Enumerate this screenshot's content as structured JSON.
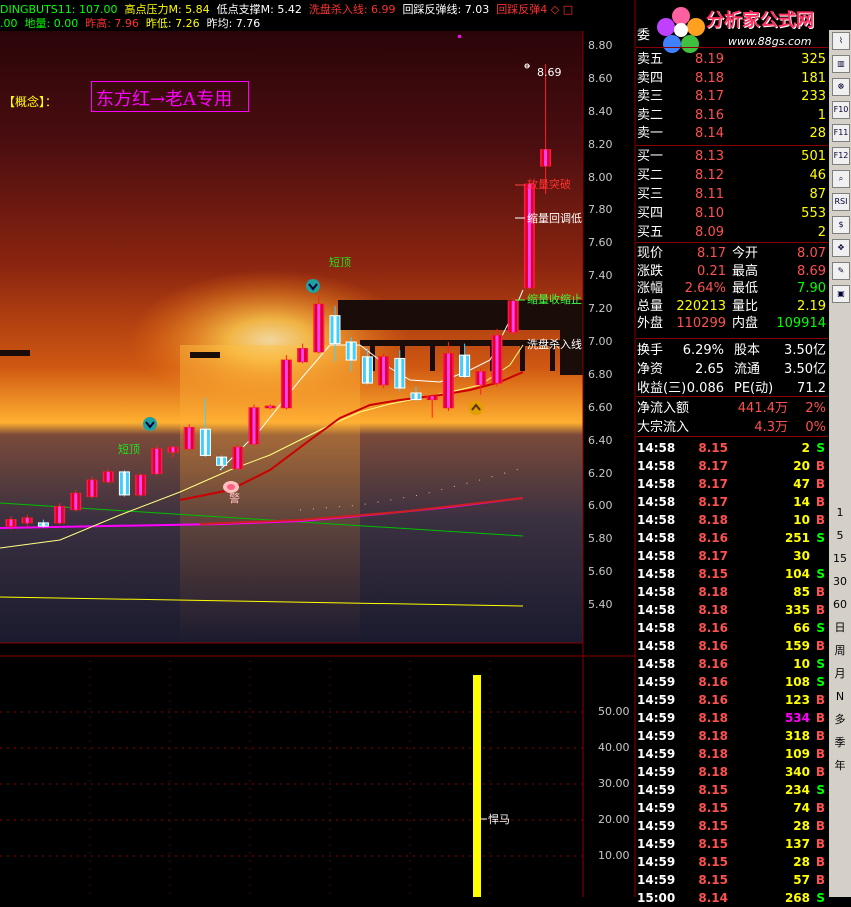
{
  "indicator_line1": [
    {
      "text": "DINGBUTS11: 107.00",
      "color": "#00ff00"
    },
    {
      "text": "高点压力M: 5.84",
      "color": "#ffff00"
    },
    {
      "text": "低点支撑M: 5.42",
      "color": "#ffffff"
    },
    {
      "text": "洗盘杀入线: 6.99",
      "color": "#ff3030"
    },
    {
      "text": "回踩反弹线: 7.03",
      "color": "#ffffff"
    },
    {
      "text": "回踩反弹4 ◇ □",
      "color": "#ff3030"
    }
  ],
  "indicator_line2": [
    {
      "text": ".00",
      "color": "#00ff00"
    },
    {
      "text": "地量: 0.00",
      "color": "#00ff00"
    },
    {
      "text": "昨高: 7.96",
      "color": "#ff3030"
    },
    {
      "text": "昨低: 7.26",
      "color": "#ffff00"
    },
    {
      "text": "昨均: 7.76",
      "color": "#ffffff"
    }
  ],
  "concept_label": "【概念】：",
  "banner": "东方红→老A专用",
  "chart_labels": {
    "peak_value": "8.69",
    "volume_breakout": "放量突破",
    "shrink_pullback": "缩量回调低",
    "shrink_consolidation": "缩量收缩止",
    "washout_entry": "洗盘杀入线",
    "short_top_1": "短顶",
    "short_top_2": "短顶",
    "warning": "警",
    "lower_marker": "悍马"
  },
  "chart_data": {
    "type": "candlestick",
    "y_axis_ticks": [
      "8.80",
      "8.60",
      "8.40",
      "8.20",
      "8.00",
      "7.80",
      "7.60",
      "7.40",
      "7.20",
      "7.00",
      "6.80",
      "6.60",
      "6.40",
      "6.20",
      "6.00",
      "5.80",
      "5.60",
      "5.40"
    ],
    "candles": [
      {
        "o": 5.88,
        "c": 5.92,
        "h": 5.94,
        "l": 5.86
      },
      {
        "o": 5.9,
        "c": 5.93,
        "h": 5.95,
        "l": 5.88
      },
      {
        "o": 5.9,
        "c": 5.88,
        "h": 5.92,
        "l": 5.87
      },
      {
        "o": 5.9,
        "c": 6.0,
        "h": 6.02,
        "l": 5.89
      },
      {
        "o": 5.98,
        "c": 6.08,
        "h": 6.1,
        "l": 5.97
      },
      {
        "o": 6.06,
        "c": 6.16,
        "h": 6.18,
        "l": 6.05
      },
      {
        "o": 6.15,
        "c": 6.21,
        "h": 6.23,
        "l": 6.14
      },
      {
        "o": 6.21,
        "c": 6.07,
        "h": 6.22,
        "l": 6.06
      },
      {
        "o": 6.07,
        "c": 6.19,
        "h": 6.2,
        "l": 6.06
      },
      {
        "o": 6.2,
        "c": 6.35,
        "h": 6.37,
        "l": 6.19
      },
      {
        "o": 6.33,
        "c": 6.36,
        "h": 6.37,
        "l": 6.3
      },
      {
        "o": 6.35,
        "c": 6.48,
        "h": 6.5,
        "l": 6.34
      },
      {
        "o": 6.47,
        "c": 6.31,
        "h": 6.66,
        "l": 6.3
      },
      {
        "o": 6.3,
        "c": 6.25,
        "h": 6.31,
        "l": 6.22
      },
      {
        "o": 6.23,
        "c": 6.36,
        "h": 6.38,
        "l": 6.22
      },
      {
        "o": 6.38,
        "c": 6.6,
        "h": 6.62,
        "l": 6.37
      },
      {
        "o": 6.6,
        "c": 6.61,
        "h": 6.62,
        "l": 6.59
      },
      {
        "o": 6.6,
        "c": 6.89,
        "h": 6.92,
        "l": 6.59
      },
      {
        "o": 6.88,
        "c": 6.96,
        "h": 6.99,
        "l": 6.87
      },
      {
        "o": 6.94,
        "c": 7.23,
        "h": 7.28,
        "l": 6.93
      },
      {
        "o": 7.16,
        "c": 6.99,
        "h": 7.22,
        "l": 6.88
      },
      {
        "o": 7.0,
        "c": 6.89,
        "h": 7.03,
        "l": 6.82
      },
      {
        "o": 6.91,
        "c": 6.75,
        "h": 6.96,
        "l": 6.74
      },
      {
        "o": 6.74,
        "c": 6.91,
        "h": 6.93,
        "l": 6.72
      },
      {
        "o": 6.9,
        "c": 6.72,
        "h": 6.95,
        "l": 6.7
      },
      {
        "o": 6.69,
        "c": 6.65,
        "h": 6.73,
        "l": 6.64
      },
      {
        "o": 6.65,
        "c": 6.67,
        "h": 6.68,
        "l": 6.54
      },
      {
        "o": 6.6,
        "c": 6.93,
        "h": 7.0,
        "l": 6.58
      },
      {
        "o": 6.92,
        "c": 6.79,
        "h": 6.99,
        "l": 6.78
      },
      {
        "o": 6.74,
        "c": 6.82,
        "h": 6.84,
        "l": 6.68
      },
      {
        "o": 6.75,
        "c": 7.04,
        "h": 7.08,
        "l": 6.73
      },
      {
        "o": 7.06,
        "c": 7.25,
        "h": 7.27,
        "l": 7.04
      },
      {
        "o": 7.33,
        "c": 7.96,
        "h": 7.98,
        "l": 7.32
      },
      {
        "o": 8.07,
        "c": 8.17,
        "h": 8.69,
        "l": 7.9
      }
    ]
  },
  "volume_axis_ticks": [
    "50.00",
    "40.00",
    "30.00",
    "20.00",
    "10.00"
  ],
  "quote_title": "委",
  "sell_orders": [
    {
      "label": "卖五",
      "price": "8.19",
      "vol": "325"
    },
    {
      "label": "卖四",
      "price": "8.18",
      "vol": "181"
    },
    {
      "label": "卖三",
      "price": "8.17",
      "vol": "233"
    },
    {
      "label": "卖二",
      "price": "8.16",
      "vol": "1"
    },
    {
      "label": "卖一",
      "price": "8.14",
      "vol": "28"
    }
  ],
  "buy_orders": [
    {
      "label": "买一",
      "price": "8.13",
      "vol": "501"
    },
    {
      "label": "买二",
      "price": "8.12",
      "vol": "46"
    },
    {
      "label": "买三",
      "price": "8.11",
      "vol": "87"
    },
    {
      "label": "买四",
      "price": "8.10",
      "vol": "553"
    },
    {
      "label": "买五",
      "price": "8.09",
      "vol": "2"
    }
  ],
  "stats": [
    {
      "k1": "现价",
      "v1": "8.17",
      "k2": "今开",
      "v2": "8.07",
      "c1": "#ff5050",
      "c2": "#ff5050"
    },
    {
      "k1": "涨跌",
      "v1": "0.21",
      "k2": "最高",
      "v2": "8.69",
      "c1": "#ff5050",
      "c2": "#ff5050"
    },
    {
      "k1": "涨幅",
      "v1": "2.64%",
      "k2": "最低",
      "v2": "7.90",
      "c1": "#ff5050",
      "c2": "#00ff00"
    },
    {
      "k1": "总量",
      "v1": "220213",
      "k2": "量比",
      "v2": "2.19",
      "c1": "#ffff00",
      "c2": "#ffff00"
    },
    {
      "k1": "外盘",
      "v1": "110299",
      "k2": "内盘",
      "v2": "109914",
      "c1": "#ff5050",
      "c2": "#00ff00"
    }
  ],
  "finance": [
    {
      "k1": "换手",
      "v1": "6.29%",
      "k2": "股本",
      "v2": "3.50亿"
    },
    {
      "k1": "净资",
      "v1": "2.65",
      "k2": "流通",
      "v2": "3.50亿"
    },
    {
      "k1": "收益(三)",
      "v1": "0.086",
      "k2": "PE(动)",
      "v2": "71.2"
    }
  ],
  "flows": [
    {
      "k": "净流入额",
      "v": "441.4万",
      "p": "2%"
    },
    {
      "k": "大宗流入",
      "v": "4.3万",
      "p": "0%"
    }
  ],
  "ticks": [
    {
      "t": "14:58",
      "p": "8.15",
      "v": "2",
      "s": "S"
    },
    {
      "t": "14:58",
      "p": "8.17",
      "v": "20",
      "s": "B"
    },
    {
      "t": "14:58",
      "p": "8.17",
      "v": "47",
      "s": "B"
    },
    {
      "t": "14:58",
      "p": "8.17",
      "v": "14",
      "s": "B"
    },
    {
      "t": "14:58",
      "p": "8.18",
      "v": "10",
      "s": "B"
    },
    {
      "t": "14:58",
      "p": "8.16",
      "v": "251",
      "s": "S"
    },
    {
      "t": "14:58",
      "p": "8.17",
      "v": "30",
      "s": ""
    },
    {
      "t": "14:58",
      "p": "8.15",
      "v": "104",
      "s": "S"
    },
    {
      "t": "14:58",
      "p": "8.18",
      "v": "85",
      "s": "B"
    },
    {
      "t": "14:58",
      "p": "8.18",
      "v": "335",
      "s": "B"
    },
    {
      "t": "14:58",
      "p": "8.16",
      "v": "66",
      "s": "S"
    },
    {
      "t": "14:58",
      "p": "8.16",
      "v": "159",
      "s": "B"
    },
    {
      "t": "14:58",
      "p": "8.16",
      "v": "10",
      "s": "S"
    },
    {
      "t": "14:59",
      "p": "8.16",
      "v": "108",
      "s": "S"
    },
    {
      "t": "14:59",
      "p": "8.16",
      "v": "123",
      "s": "B"
    },
    {
      "t": "14:59",
      "p": "8.18",
      "v": "534",
      "s": "B"
    },
    {
      "t": "14:59",
      "p": "8.18",
      "v": "318",
      "s": "B"
    },
    {
      "t": "14:59",
      "p": "8.18",
      "v": "109",
      "s": "B"
    },
    {
      "t": "14:59",
      "p": "8.18",
      "v": "340",
      "s": "B"
    },
    {
      "t": "14:59",
      "p": "8.15",
      "v": "234",
      "s": "S"
    },
    {
      "t": "14:59",
      "p": "8.15",
      "v": "74",
      "s": "B"
    },
    {
      "t": "14:59",
      "p": "8.15",
      "v": "28",
      "s": "B"
    },
    {
      "t": "14:59",
      "p": "8.15",
      "v": "137",
      "s": "B"
    },
    {
      "t": "14:59",
      "p": "8.15",
      "v": "28",
      "s": "B"
    },
    {
      "t": "14:59",
      "p": "8.15",
      "v": "57",
      "s": "B"
    },
    {
      "t": "15:00",
      "p": "8.14",
      "v": "268",
      "s": "S"
    }
  ],
  "logo": {
    "title": "分析家公式网",
    "url": "www.88gs.com"
  },
  "sidebar_buttons": [
    "1",
    "5",
    "15",
    "30",
    "60",
    "日",
    "周",
    "月",
    "N",
    "多",
    "季",
    "年"
  ],
  "sidebar_icons": [
    "chart-line-icon",
    "candlestick-icon",
    "compass-icon",
    "F10",
    "F11",
    "F12",
    "search-icon",
    "rsi-icon",
    "dollar-icon",
    "move-icon",
    "pen-icon",
    "image-icon"
  ],
  "sidebar_icon_glyphs": [
    "⌇",
    "▥",
    "☸",
    "F10",
    "F11",
    "F12",
    "⌕",
    "RSI",
    "$",
    "✥",
    "✎",
    "▣"
  ]
}
